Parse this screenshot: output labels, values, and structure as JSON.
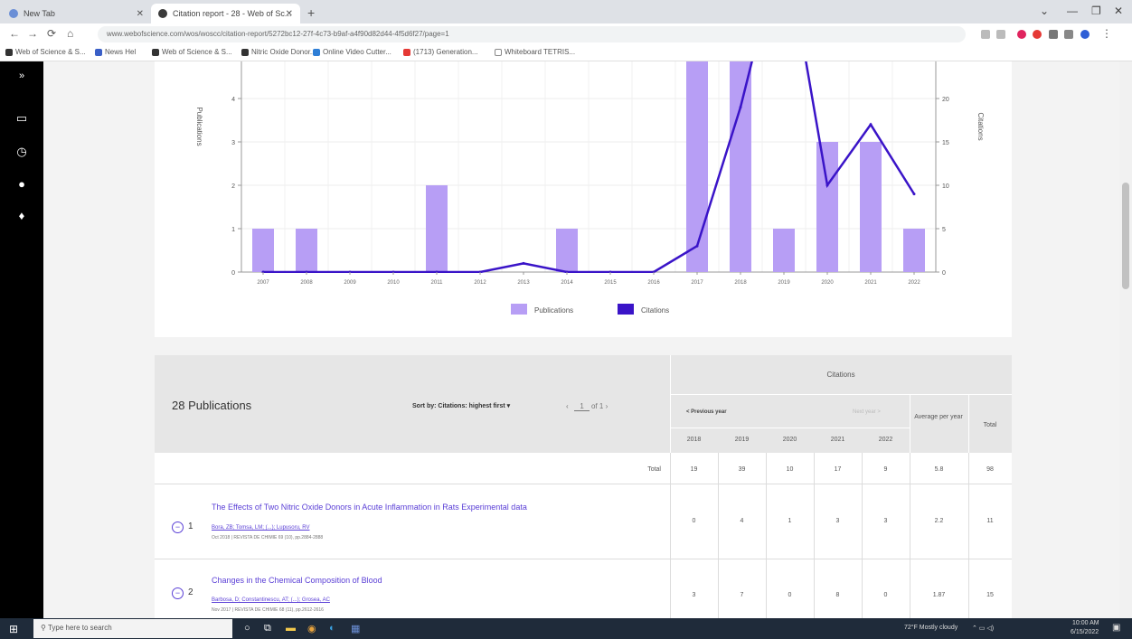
{
  "browser": {
    "tabs": [
      {
        "label": "New Tab"
      },
      {
        "label": "Citation report - 28 - Web of Sc..."
      }
    ],
    "new_tab": "+",
    "url": "www.webofscience.com/wos/woscc/citation-report/5272bc12-27f-4c73-b9af-a4f90d82d44-4f5d6f27/page=1",
    "bookmarks": [
      {
        "label": "Web of Science & S..."
      },
      {
        "label": "News Hel"
      },
      {
        "label": "Web of Science & S..."
      },
      {
        "label": "Nitric Oxide Donor..."
      },
      {
        "label": "Online Video Cutter..."
      },
      {
        "label": "(1713) Generation..."
      },
      {
        "label": "Whiteboard TETRIS..."
      }
    ]
  },
  "chart_data": {
    "type": "bar",
    "categories": [
      "2007",
      "2008",
      "2009",
      "2010",
      "2011",
      "2012",
      "2013",
      "2014",
      "2015",
      "2016",
      "2017",
      "2018",
      "2019",
      "2020",
      "2021",
      "2022"
    ],
    "series": [
      {
        "name": "Publications",
        "values": [
          1,
          1,
          0,
          0,
          2,
          0,
          0,
          1,
          0,
          0,
          10,
          10,
          1,
          3,
          3,
          1
        ],
        "axis": "left",
        "color": "#b79ef5"
      },
      {
        "name": "Citations",
        "values": [
          0,
          0,
          0,
          0,
          0,
          0,
          1,
          0,
          0,
          0,
          3,
          19,
          39,
          10,
          17,
          9
        ],
        "axis": "right",
        "color": "#3a14c8",
        "type": "line"
      }
    ],
    "ylabel": "Publications",
    "y2label": "Citations",
    "left_ticks": [
      0,
      1,
      2,
      3,
      4
    ],
    "right_ticks": [
      0,
      5,
      10,
      15,
      20
    ],
    "legend": [
      "Publications",
      "Citations"
    ]
  },
  "table": {
    "pub_count": "28 Publications",
    "sort_label": "Sort by: Citations: highest first",
    "pager": {
      "page": "1",
      "of": "of 1"
    },
    "citations_title": "Citations",
    "prev_year": "< Previous year",
    "next_year": "Next year >",
    "years": [
      "2018",
      "2019",
      "2020",
      "2021",
      "2022"
    ],
    "avg_header": "Average per year",
    "total_header": "Total",
    "total_row": {
      "label": "Total",
      "values": [
        "19",
        "39",
        "10",
        "17",
        "9"
      ],
      "avg": "5.8",
      "total": "98"
    },
    "rows": [
      {
        "index": "1",
        "title": "The Effects of Two Nitric Oxide Donors in Acute Inflammation in Rats Experimental data",
        "authors": "Bora, ZB; Tomsa, LM; (...); Lupusoru, RV",
        "source": "Oct 2018 | REVISTA DE CHIMIE 69 (10), pp.2884-2888",
        "values": [
          "0",
          "4",
          "1",
          "3",
          "3"
        ],
        "avg": "2.2",
        "total": "11"
      },
      {
        "index": "2",
        "title": "Changes in the Chemical Composition of Blood",
        "authors": "Barbosa, D; Constantinescu, AT; (...); Grosea, AC",
        "source": "Nov 2017 | REVISTA DE CHIMIE 68 (11), pp.2612-2616",
        "values": [
          "3",
          "7",
          "0",
          "8",
          "0"
        ],
        "avg": "1.87",
        "total": "15"
      }
    ]
  },
  "taskbar": {
    "search_placeholder": "Type here to search",
    "weather": "72°F Mostly cloudy",
    "time": "10:00 AM",
    "date": "6/15/2022"
  }
}
